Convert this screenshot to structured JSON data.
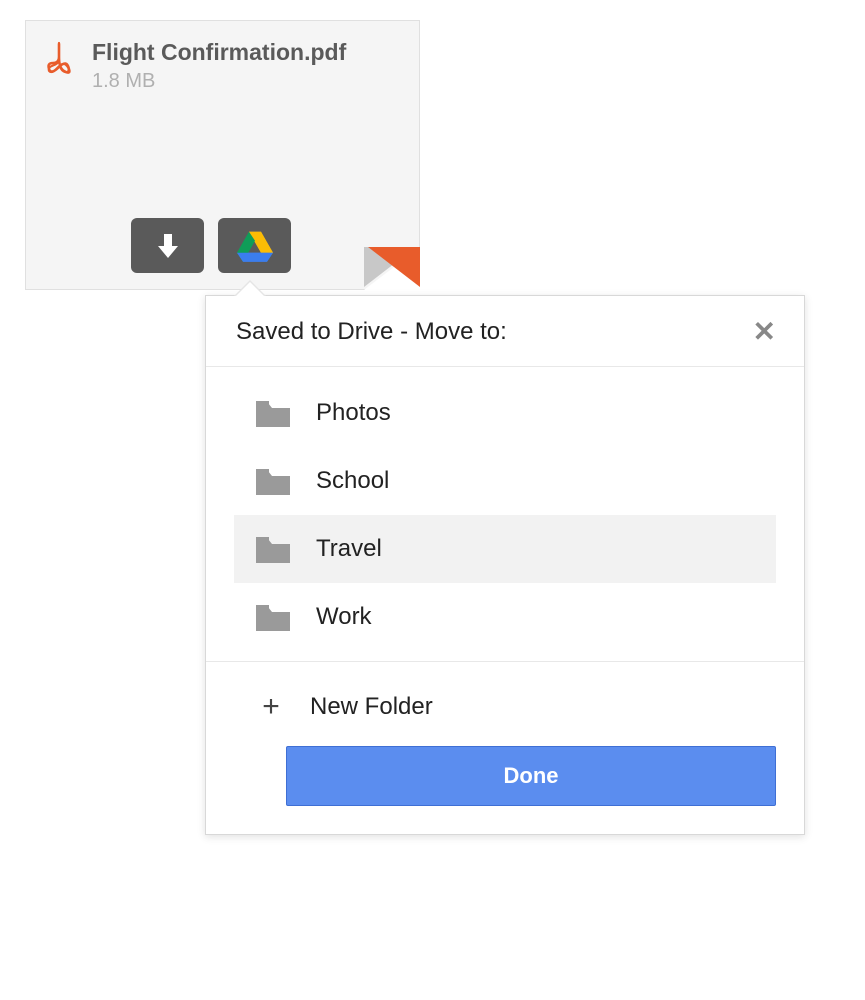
{
  "attachment": {
    "name": "Flight Confirmation.pdf",
    "size": "1.8 MB"
  },
  "popover": {
    "title": "Saved to Drive - Move to:",
    "newFolderLabel": "New Folder",
    "doneLabel": "Done"
  },
  "folders": [
    {
      "label": "Photos",
      "selected": false
    },
    {
      "label": "School",
      "selected": false
    },
    {
      "label": "Travel",
      "selected": true
    },
    {
      "label": "Work",
      "selected": false
    }
  ],
  "colors": {
    "accent": "#5b8def",
    "pdf": "#e85c2b",
    "folder": "#9a9a9a"
  }
}
